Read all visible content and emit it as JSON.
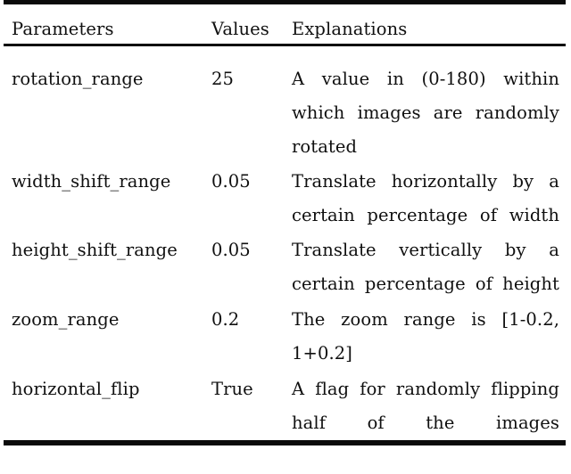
{
  "table": {
    "caption_visible": false,
    "columns": [
      "Parameters",
      "Values",
      "Explanations"
    ],
    "rows": [
      {
        "parameter": "rotation_range",
        "value": "25",
        "explanation": "A value in (0-180) within which images are randomly rotated"
      },
      {
        "parameter": "width_shift_range",
        "value": "0.05",
        "explanation": "Translate horizontally by a certain percentage of width"
      },
      {
        "parameter": "height_shift_range",
        "value": "0.05",
        "explanation": "Translate vertically by a certain percentage of height"
      },
      {
        "parameter": "zoom_range",
        "value": "0.2",
        "explanation": "The zoom range is [1-0.2, 1+0.2]"
      },
      {
        "parameter": "horizontal_flip",
        "value": "True",
        "explanation": "A flag for randomly flipping half of the images"
      }
    ]
  },
  "style": {
    "rule_color": "#0b0b0b",
    "text_color": "#101010",
    "background": "#ffffff"
  }
}
